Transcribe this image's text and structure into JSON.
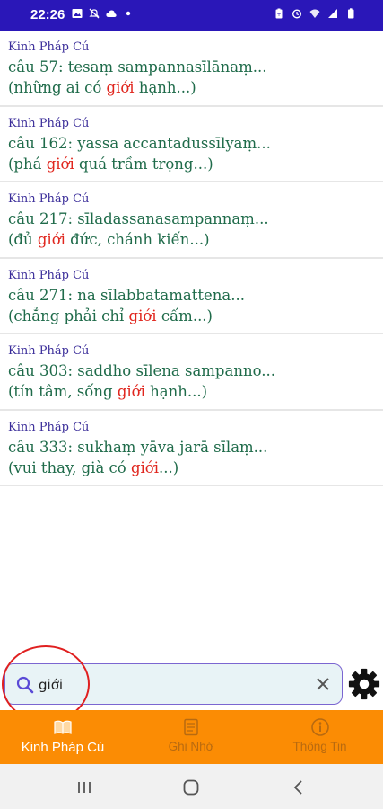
{
  "status_bar": {
    "time": "22:26",
    "left_icons": [
      "image-icon",
      "mute-icon",
      "cloud-icon",
      "dot-icon"
    ],
    "right_icons": [
      "battery-saver-icon",
      "alarm-icon",
      "wifi-icon",
      "signal-icon",
      "battery-icon"
    ]
  },
  "results": [
    {
      "source": "Kinh Pháp Cú",
      "verse": "câu 57: tesaṃ sampannasīlānaṃ...",
      "meaning_before": "(những ai có ",
      "keyword": "giới",
      "meaning_after": " hạnh...)"
    },
    {
      "source": "Kinh Pháp Cú",
      "verse": "câu 162: yassa accantadussīlyaṃ...",
      "meaning_before": "(phá ",
      "keyword": "giới",
      "meaning_after": " quá trầm trọng...)"
    },
    {
      "source": "Kinh Pháp Cú",
      "verse": "câu 217: sīladassanasampannaṃ...",
      "meaning_before": "(đủ ",
      "keyword": "giới",
      "meaning_after": " đức, chánh kiến...)"
    },
    {
      "source": "Kinh Pháp Cú",
      "verse": "câu 271: na sīlabbatamattena...",
      "meaning_before": "(chẳng phải chỉ ",
      "keyword": "giới",
      "meaning_after": " cấm...)"
    },
    {
      "source": "Kinh Pháp Cú",
      "verse": "câu 303: saddho sīlena sampanno...",
      "meaning_before": "(tín tâm, sống ",
      "keyword": "giới",
      "meaning_after": " hạnh...)"
    },
    {
      "source": "Kinh Pháp Cú",
      "verse": "câu 333: sukhaṃ yāva jarā sīlaṃ...",
      "meaning_before": "(vui thay, già có ",
      "keyword": "giới",
      "meaning_after": "...)"
    }
  ],
  "search": {
    "value": "giới",
    "clear_icon": "close-icon",
    "search_icon": "search-icon"
  },
  "settings_icon": "gear-icon",
  "bottom_nav": [
    {
      "label": "Kinh Pháp Cú",
      "icon": "book-icon",
      "active": true
    },
    {
      "label": "Ghi Nhớ",
      "icon": "notes-icon",
      "active": false
    },
    {
      "label": "Thông Tin",
      "icon": "info-icon",
      "active": false
    }
  ],
  "system_nav": [
    "recents-icon",
    "home-icon",
    "back-icon"
  ],
  "colors": {
    "status_bar": "#2a17b8",
    "accent": "#fb8c04",
    "highlight": "#e0261e",
    "text_green": "#1f6b4a",
    "source_purple": "#3b2e9a"
  }
}
